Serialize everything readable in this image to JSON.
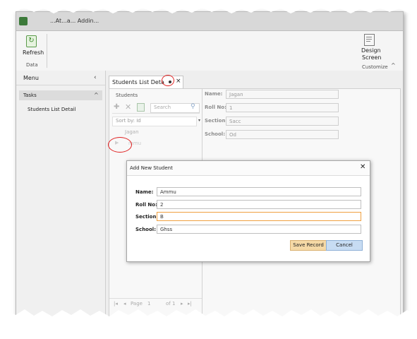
{
  "app": {
    "title": "...At...a... Addin..."
  },
  "ribbon": {
    "refresh_label": "Refresh",
    "data_group_label": "Data",
    "design_line1": "Design",
    "design_line2": "Screen",
    "customize_group_label": "Customize"
  },
  "nav": {
    "menu_label": "Menu",
    "tasks_label": "Tasks",
    "items": [
      {
        "label": "Students List Detail"
      }
    ]
  },
  "tab": {
    "label": "Students List Deta"
  },
  "list": {
    "header": "Students",
    "search_placeholder": "Search",
    "sort_label": "Sort by: Id",
    "rows": [
      {
        "name": "Jagan"
      },
      {
        "name": "mmu"
      }
    ],
    "pager": {
      "page_label": "Page",
      "page_value": "1",
      "of_label": "of 1"
    }
  },
  "detail": {
    "name_label": "Name:",
    "name_value": "Jagan",
    "rollno_label": "Roll No:",
    "rollno_value": "1",
    "section_label": "Section:",
    "section_value": "Sacc",
    "school_label": "School:",
    "school_value": "Od"
  },
  "dialog": {
    "title": "Add New Student",
    "name_label": "Name:",
    "name_value": "Ammu",
    "rollno_label": "Roll No:",
    "rollno_value": "2",
    "section_label": "Section:",
    "section_value": "B",
    "school_label": "School:",
    "school_value": "Ghss",
    "save_label": "Save Record",
    "cancel_label": "Cancel"
  },
  "colors": {
    "annotation": "#e02020",
    "save_bg": "#f5d9a6",
    "cancel_bg": "#c7dcf3",
    "focus_border": "#f0a040"
  }
}
